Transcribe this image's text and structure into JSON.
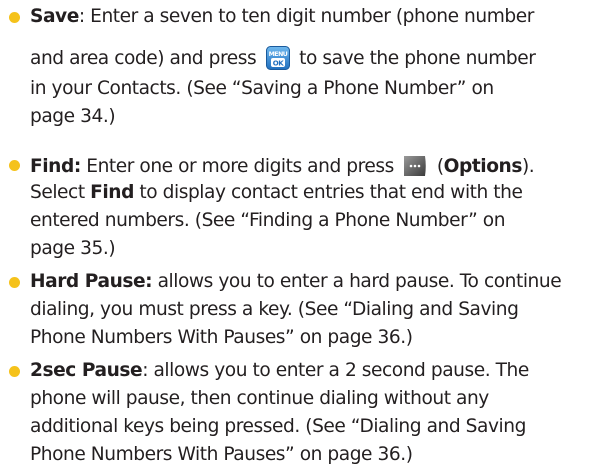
{
  "items": [
    {
      "l1_term": "Save",
      "l1_text": ": Enter a seven to ten digit number (phone number",
      "l2_before": "and area code) and press",
      "l2_after": "to save the phone number",
      "l3": "in your Contacts. (See “Saving a Phone Number” on",
      "l4": "page 34.)",
      "key_label_top": "MENU",
      "key_label_bottom": "OK"
    },
    {
      "l1_term": "Find:",
      "l1_before": " Enter one or more digits and press",
      "l1_paren_open": "(",
      "l1_options": "Options",
      "l1_paren_close": ").",
      "l2_before": "Select ",
      "l2_find": "Find",
      "l2_after": " to display contact entries that end with the",
      "l3": "entered numbers. (See “Finding a Phone Number” on",
      "l4": "page 35.)"
    },
    {
      "l1_term": "Hard Pause:",
      "l1_text": " allows you to enter a hard pause. To continue",
      "l2": "dialing, you must press a key. (See “Dialing and Saving",
      "l3": "Phone Numbers With Pauses” on page 36.)"
    },
    {
      "l1_term": "2sec Pause",
      "l1_text": ": allows you to enter a 2 second pause. The",
      "l2": "phone will pause, then continue dialing without any",
      "l3": "additional keys being pressed. (See “Dialing and Saving",
      "l4": "Phone Numbers With Pauses” on page 36.)"
    }
  ],
  "icons": {
    "menu_ok_key": "menu-ok-key-icon",
    "options_softkey": "right-softkey-icon"
  },
  "colors": {
    "bullet": "#f5c21b",
    "text": "#231f20",
    "menu_key_fill": "#2f8ad6",
    "softkey_fill": "#4a4a4a"
  }
}
